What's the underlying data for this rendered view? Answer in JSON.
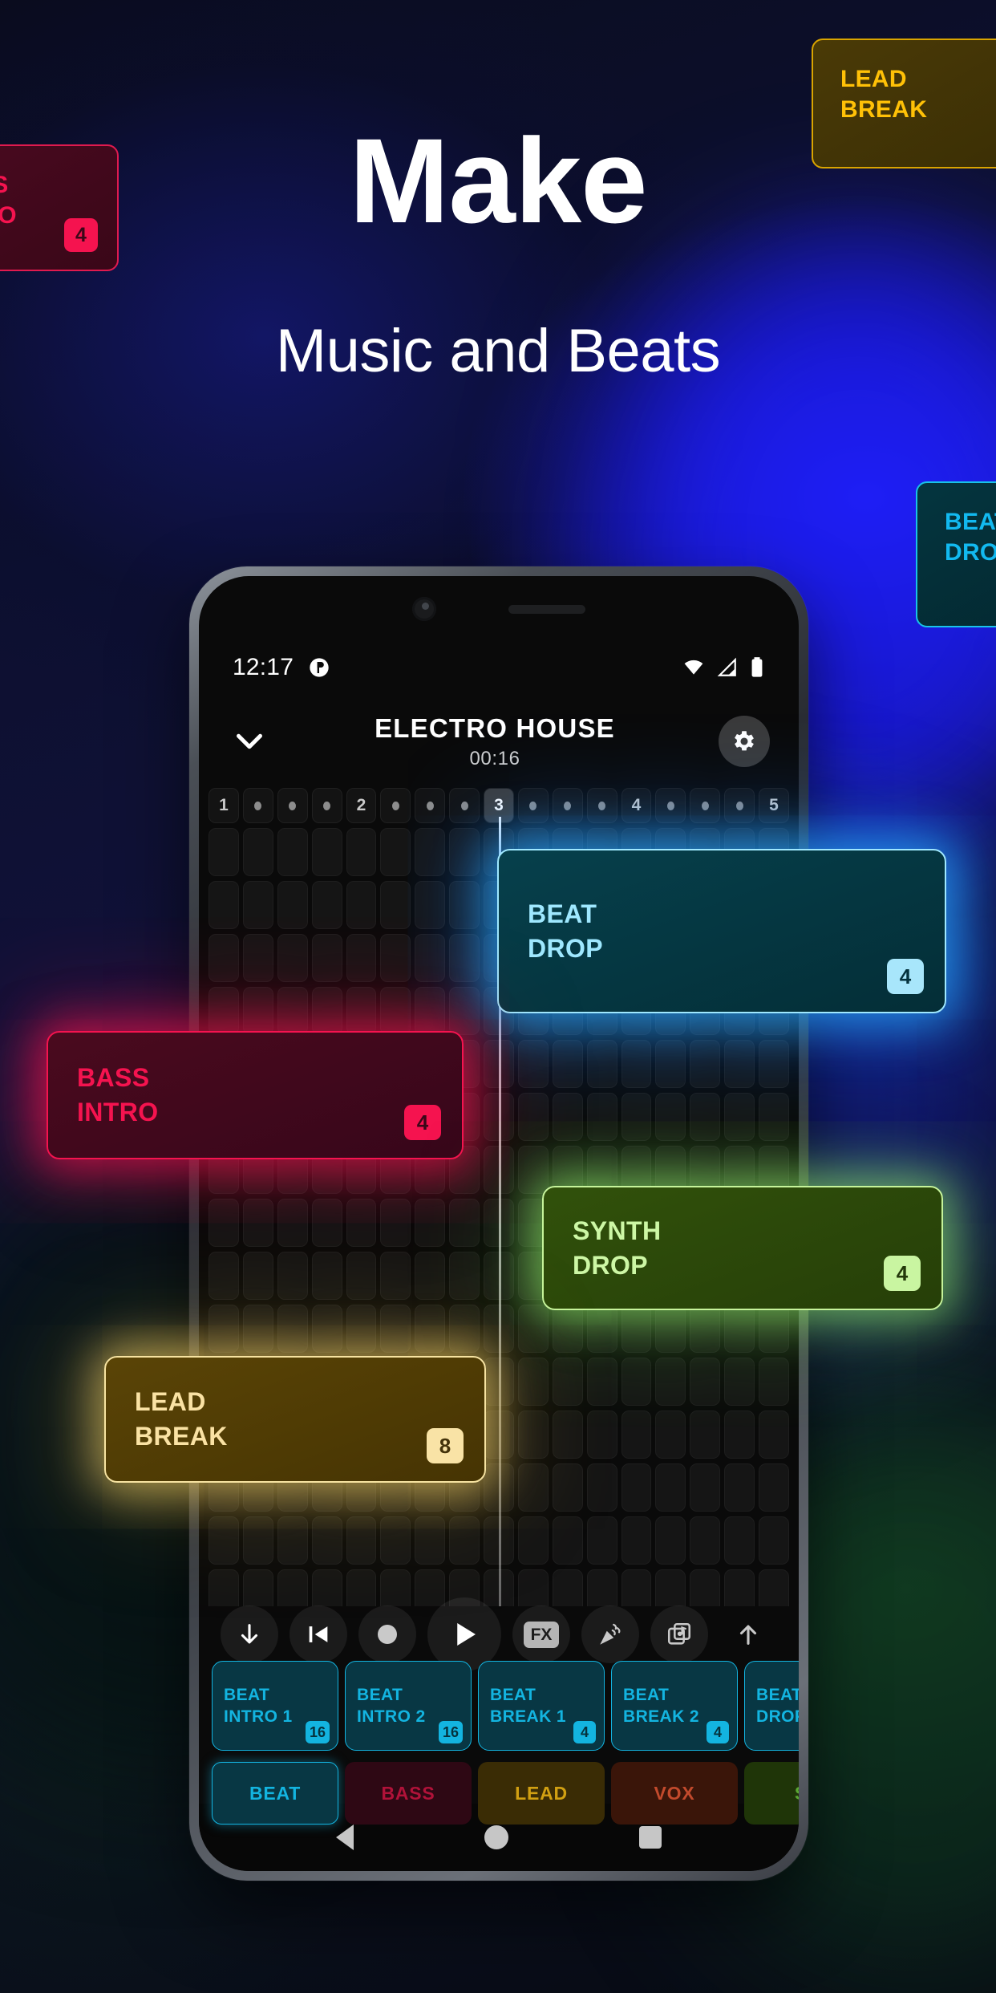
{
  "hero": {
    "headline": "Make",
    "subhead": "Music and Beats"
  },
  "edge_cards": [
    {
      "name": "lead-break",
      "line1": "LEAD",
      "line2": "BREAK",
      "badge": "",
      "accent": "#ffc107"
    },
    {
      "name": "bass-intro",
      "line1": "BASS",
      "line2": "INTRO",
      "badge": "4",
      "accent": "#f5134f"
    },
    {
      "name": "beat-drop",
      "line1": "BEAT",
      "line2": "DROP",
      "badge": "",
      "accent": "#12b9f0"
    }
  ],
  "phone": {
    "statusbar": {
      "time": "12:17",
      "notification_icon": "app-notification-icon",
      "wifi_icon": "wifi-icon",
      "signal_icon": "cell-signal-icon",
      "battery_icon": "battery-icon"
    },
    "header": {
      "collapse_icon": "chevron-down-icon",
      "title": "ELECTRO HOUSE",
      "time": "00:16",
      "settings_icon": "gear-icon"
    },
    "ruler": {
      "cells": [
        "1",
        "•",
        "•",
        "•",
        "2",
        "•",
        "•",
        "•",
        "3",
        "•",
        "•",
        "•",
        "4",
        "•",
        "•",
        "•",
        "5"
      ],
      "active_index": 8
    },
    "transport": [
      {
        "name": "download-button",
        "icon": "arrow-down-icon"
      },
      {
        "name": "skip-to-start-button",
        "icon": "skip-previous-icon"
      },
      {
        "name": "record-button",
        "icon": "record-circle-icon"
      },
      {
        "name": "play-button",
        "icon": "play-icon"
      },
      {
        "name": "fx-button",
        "icon": "fx-icon",
        "label": "FX"
      },
      {
        "name": "effects-button",
        "icon": "confetti-icon"
      },
      {
        "name": "library-button",
        "icon": "music-library-icon"
      },
      {
        "name": "upload-button",
        "icon": "arrow-up-icon"
      }
    ],
    "slots": [
      {
        "line1": "BEAT",
        "line2": "INTRO 1",
        "badge": "16"
      },
      {
        "line1": "BEAT",
        "line2": "INTRO 2",
        "badge": "16"
      },
      {
        "line1": "BEAT",
        "line2": "BREAK 1",
        "badge": "4"
      },
      {
        "line1": "BEAT",
        "line2": "BREAK 2",
        "badge": "4"
      },
      {
        "line1": "BEAT",
        "line2": "DROP",
        "badge": ""
      }
    ],
    "tabs": [
      {
        "label": "BEAT",
        "color": "#13b4e0",
        "bg": "#083744",
        "active": true
      },
      {
        "label": "BASS",
        "color": "#b01239",
        "bg": "#2e0814",
        "active": false
      },
      {
        "label": "LEAD",
        "color": "#d1a012",
        "bg": "#3a2c05",
        "active": false
      },
      {
        "label": "VOX",
        "color": "#c24a2c",
        "bg": "#3a1509",
        "active": false
      },
      {
        "label": "SY",
        "color": "#5aa832",
        "bg": "#1f3508",
        "active": false
      }
    ],
    "navbar": {
      "back_icon": "triangle-back-icon",
      "home_icon": "circle-home-icon",
      "recents_icon": "square-recents-icon"
    }
  },
  "overlay_clips": [
    {
      "name": "beat-drop",
      "line1": "BEAT",
      "line2": "DROP",
      "badge": "4",
      "accent": "#9fe8ff"
    },
    {
      "name": "bass-intro",
      "line1": "BASS",
      "line2": "INTRO",
      "badge": "4",
      "accent": "#f5134f"
    },
    {
      "name": "synth-drop",
      "line1": "SYNTH",
      "line2": "DROP",
      "badge": "4",
      "accent": "#cdf7a5"
    },
    {
      "name": "lead-break",
      "line1": "LEAD",
      "line2": "BREAK",
      "badge": "8",
      "accent": "#fae2a4"
    }
  ]
}
